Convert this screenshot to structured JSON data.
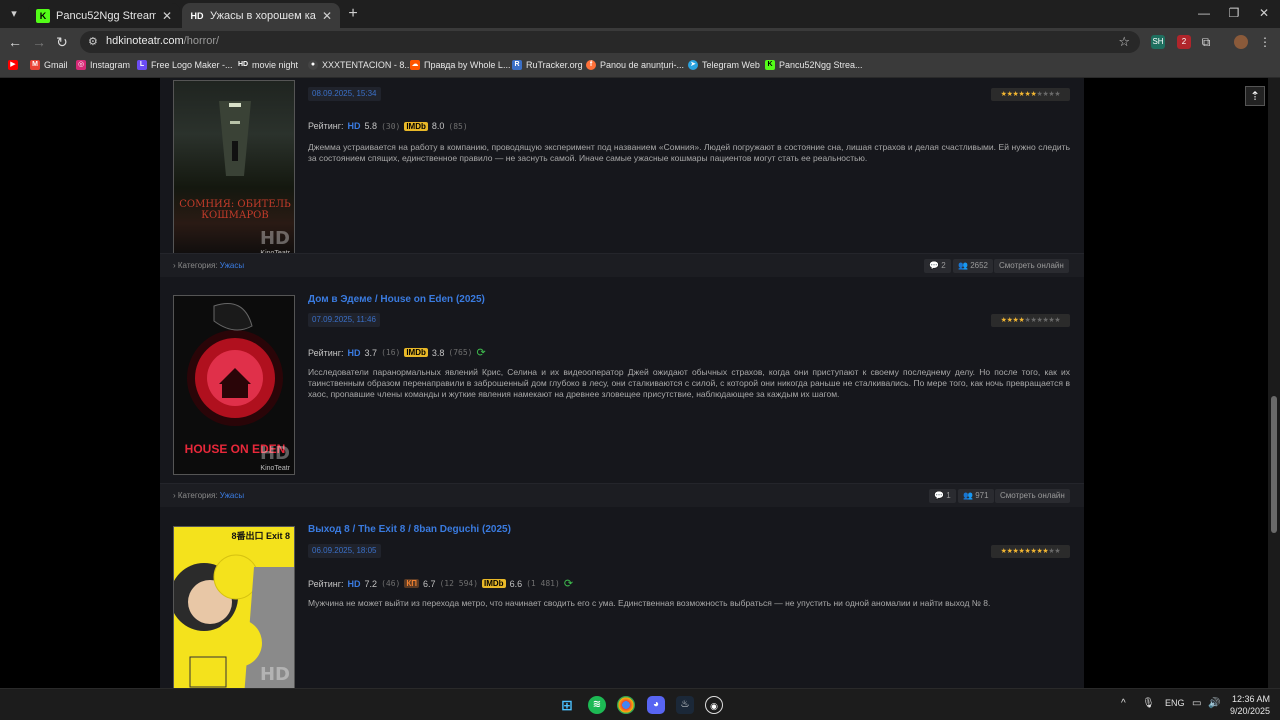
{
  "browser": {
    "tabs": [
      {
        "favicon": "K",
        "title": "Pancu52Ngg Stream - Watch L",
        "favicon_color": "#53fc18"
      },
      {
        "favicon": "HD",
        "title": "Ужасы в хорошем качестве »",
        "favicon_color": "#ffffff"
      }
    ],
    "url_host": "hdkinoteatr.com",
    "url_path": "/horror/",
    "bookmarks": [
      {
        "label": "",
        "icon": "youtube-icon",
        "color": "#ff0000"
      },
      {
        "label": "Gmail",
        "icon": "gmail-icon",
        "color": "#ea4335"
      },
      {
        "label": "Instagram",
        "icon": "instagram-icon",
        "color": "#d62976"
      },
      {
        "label": "Free Logo Maker -...",
        "icon": "logo-maker-icon",
        "color": "#6b4cf5"
      },
      {
        "label": "movie night",
        "icon": "hd-icon",
        "color": "#333333"
      },
      {
        "label": "XXXTENTACION - 8...",
        "icon": "music-icon",
        "color": "#444444"
      },
      {
        "label": "Правда by Whole L...",
        "icon": "soundcloud-icon",
        "color": "#ff5500"
      },
      {
        "label": "RuTracker.org",
        "icon": "rutracker-icon",
        "color": "#3a6fc6"
      },
      {
        "label": "Panou de anunțuri-...",
        "icon": "firefox-icon",
        "color": "#ff7139"
      },
      {
        "label": "Telegram Web",
        "icon": "telegram-icon",
        "color": "#2aa3e0"
      },
      {
        "label": "Pancu52Ngg Strea...",
        "icon": "kick-icon",
        "color": "#53fc18"
      }
    ]
  },
  "entries": [
    {
      "title": "",
      "date": "08.09.2025, 15:34",
      "stars_on": 6,
      "stars_total": 10,
      "rating_label": "Рейтинг:",
      "hd_score": "5.8",
      "hd_votes": "(30)",
      "kp_score": "",
      "kp_votes": "",
      "imdb_score": "8.0",
      "imdb_votes": "(85)",
      "refresh": false,
      "description": "Джемма устраивается на работу в компанию, проводящую эксперимент под названием «Сомния». Людей погружают в состояние сна, лишая страхов и делая счастливыми. Ей нужно следить за состоянием спящих, единственное правило — не заснуть самой. Иначе самые ужасные кошмары пациентов могут стать ее реальностью.",
      "poster_caption": "СОМНИЯ: ОБИТЕЛЬ КОШМАРОВ",
      "category_label": "Категория:",
      "category": "Ужасы",
      "comments": "2",
      "views": "2652",
      "watch": "Смотреть онлайн"
    },
    {
      "title": "Дом в Эдеме / House on Eden (2025)",
      "date": "07.09.2025, 11:46",
      "stars_on": 4,
      "stars_total": 10,
      "rating_label": "Рейтинг:",
      "hd_score": "3.7",
      "hd_votes": "(16)",
      "kp_score": "",
      "kp_votes": "",
      "imdb_score": "3.8",
      "imdb_votes": "(765)",
      "refresh": true,
      "description": "Исследователи паранормальных явлений Крис, Селина и их видеооператор Джей ожидают обычных страхов, когда они приступают к своему последнему делу. Но после того, как их таинственным образом перенаправили в заброшенный дом глубоко в лесу, они сталкиваются с силой, с которой они никогда раньше не сталкивались. По мере того, как ночь превращается в хаос, пропавшие члены команды и жуткие явления намекают на древнее зловещее присутствие, наблюдающее за каждым их шагом.",
      "poster_caption": "HOUSE ON EDEN",
      "category_label": "Категория:",
      "category": "Ужасы",
      "comments": "1",
      "views": "971",
      "watch": "Смотреть онлайн"
    },
    {
      "title": "Выход 8 / The Exit 8 / 8ban Deguchi (2025)",
      "date": "06.09.2025, 18:05",
      "stars_on": 8,
      "stars_total": 10,
      "rating_label": "Рейтинг:",
      "hd_score": "7.2",
      "hd_votes": "(46)",
      "kp_score": "6.7",
      "kp_votes": "(12 594)",
      "imdb_score": "6.6",
      "imdb_votes": "(1 481)",
      "refresh": true,
      "description": "Мужчина не может выйти из перехода метро, что начинает сводить его с ума. Единственная возможность выбраться — не упустить ни одной аномалии и найти выход № 8.",
      "poster_caption": "8番出口 Exit 8",
      "category_label": "",
      "category": "",
      "comments": "",
      "views": "",
      "watch": ""
    }
  ],
  "labels": {
    "hd": "HD",
    "imdb": "IMDb",
    "kp": "КП",
    "watermark": "KinoTeatr"
  },
  "taskbar": {
    "lang": "ENG",
    "time": "12:36 AM",
    "date": "9/20/2025"
  }
}
